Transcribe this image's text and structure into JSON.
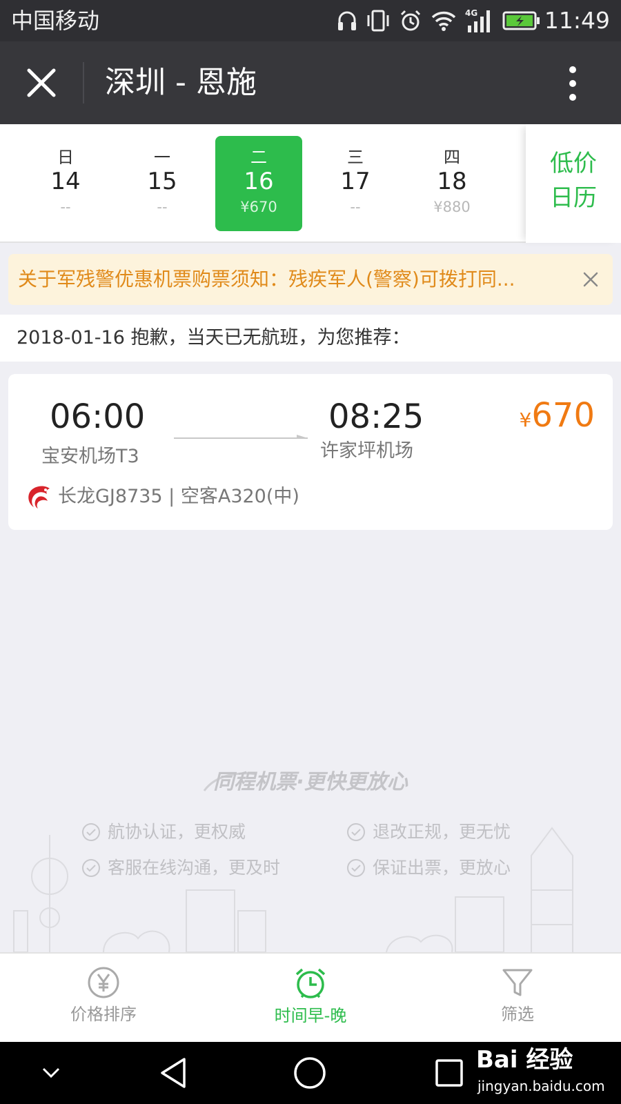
{
  "status_bar": {
    "carrier": "中国移动",
    "network": "4G",
    "time": "11:49"
  },
  "header": {
    "title": "深圳 - 恩施"
  },
  "date_strip": {
    "days": [
      {
        "weekday": "日",
        "date": "14",
        "price": "--"
      },
      {
        "weekday": "一",
        "date": "15",
        "price": "--"
      },
      {
        "weekday": "二",
        "date": "16",
        "price": "¥670",
        "selected": true
      },
      {
        "weekday": "三",
        "date": "17",
        "price": "--"
      },
      {
        "weekday": "四",
        "date": "18",
        "price": "¥880"
      }
    ],
    "low_price_calendar": {
      "line1": "低价",
      "line2": "日历"
    }
  },
  "notice": {
    "text": "关于军残警优惠机票购票须知：残疾军人(警察)可拨打同..."
  },
  "hint": {
    "text": "2018-01-16 抱歉，当天已无航班，为您推荐："
  },
  "flight": {
    "departure_time": "06:00",
    "departure_airport": "宝安机场T3",
    "arrival_time": "08:25",
    "arrival_airport": "许家坪机场",
    "currency": "¥",
    "price": "670",
    "airline_info": "长龙GJ8735 | 空客A320(中)"
  },
  "brand": {
    "slogan": "同程机票·更快更放心",
    "guarantees": [
      "航协认证，更权威",
      "退改正规，更无忧",
      "客服在线沟通，更及时",
      "保证出票，更放心"
    ]
  },
  "tabs": [
    {
      "label": "价格排序",
      "icon": "yen-circle-icon",
      "active": false
    },
    {
      "label": "时间早-晚",
      "icon": "alarm-clock-icon",
      "active": true
    },
    {
      "label": "筛选",
      "icon": "filter-icon",
      "active": false
    }
  ],
  "watermark": {
    "top": "Bai 经验",
    "bottom": "jingyan.baidu.com"
  },
  "colors": {
    "accent_green": "#2dbc4c",
    "price_orange": "#f07a12",
    "notice_bg": "#fdf3dc",
    "notice_text": "#e08a1a",
    "header_bg": "#37373b"
  }
}
